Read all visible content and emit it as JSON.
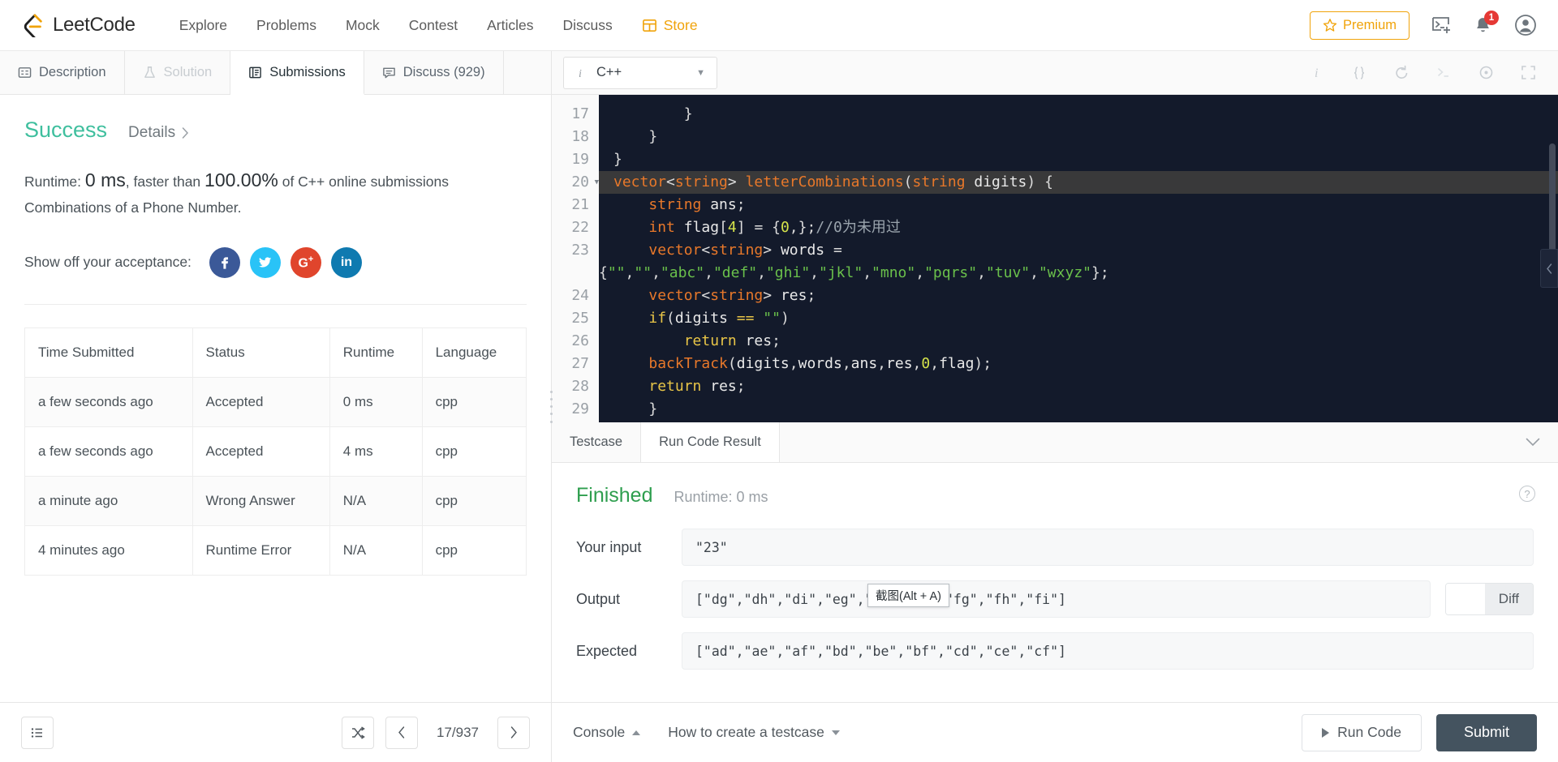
{
  "navbar": {
    "brand": "LeetCode",
    "links": [
      "Explore",
      "Problems",
      "Mock",
      "Contest",
      "Articles",
      "Discuss"
    ],
    "store_label": "Store",
    "premium_label": "Premium",
    "notification_count": "1"
  },
  "left": {
    "tabs": [
      {
        "label": "Description",
        "icon": "description-icon",
        "state": "normal"
      },
      {
        "label": "Solution",
        "icon": "solution-flask-icon",
        "state": "disabled"
      },
      {
        "label": "Submissions",
        "icon": "submissions-icon",
        "state": "active"
      },
      {
        "label": "Discuss (929)",
        "icon": "discuss-icon",
        "state": "normal"
      }
    ],
    "result": {
      "status": "Success",
      "details_label": "Details",
      "runtime_prefix": "Runtime:",
      "runtime_value": "0 ms",
      "faster_text": ", faster than ",
      "percentile": "100.00%",
      "tail_text": " of C++ online submissions Combinations of a Phone Number."
    },
    "share": {
      "label": "Show off your acceptance:",
      "networks": [
        "facebook",
        "twitter",
        "google-plus",
        "linkedin"
      ]
    },
    "table": {
      "headers": [
        "Time Submitted",
        "Status",
        "Runtime",
        "Language"
      ],
      "rows": [
        {
          "time": "a few seconds ago",
          "status": "Accepted",
          "status_kind": "accepted",
          "runtime": "0 ms",
          "language": "cpp"
        },
        {
          "time": "a few seconds ago",
          "status": "Accepted",
          "status_kind": "accepted",
          "runtime": "4 ms",
          "language": "cpp"
        },
        {
          "time": "a minute ago",
          "status": "Wrong Answer",
          "status_kind": "wrong",
          "runtime": "N/A",
          "language": "cpp"
        },
        {
          "time": "4 minutes ago",
          "status": "Runtime Error",
          "status_kind": "error",
          "runtime": "N/A",
          "language": "cpp"
        }
      ]
    },
    "footer": {
      "list_icon": "problem-list-icon",
      "shuffle_icon": "shuffle-icon",
      "prev_icon": "chevron-left-icon",
      "page_indicator": "17/937",
      "next_icon": "chevron-right-icon"
    }
  },
  "editor": {
    "language": "C++",
    "lang_info_icon": "info-icon",
    "tools": [
      "info-icon",
      "format-braces-icon",
      "reset-icon",
      "console-icon",
      "settings-gear-icon",
      "fullscreen-icon"
    ],
    "lines": [
      {
        "num": "17",
        "fold": false,
        "highlight": false,
        "tokens": [
          {
            "t": "        }",
            "c": "k-pun"
          }
        ]
      },
      {
        "num": "18",
        "fold": false,
        "highlight": false,
        "tokens": [
          {
            "t": "    }",
            "c": "k-pun"
          }
        ]
      },
      {
        "num": "19",
        "fold": false,
        "highlight": false,
        "tokens": [
          {
            "t": "}",
            "c": "k-pun"
          }
        ]
      },
      {
        "num": "20",
        "fold": true,
        "highlight": true,
        "tokens": [
          {
            "t": "vector",
            "c": "k-type"
          },
          {
            "t": "<",
            "c": "k-pun"
          },
          {
            "t": "string",
            "c": "k-type"
          },
          {
            "t": "> ",
            "c": "k-pun"
          },
          {
            "t": "letterCombinations",
            "c": "k-fn"
          },
          {
            "t": "(",
            "c": "k-pun"
          },
          {
            "t": "string ",
            "c": "k-type"
          },
          {
            "t": "digits",
            "c": "k-var"
          },
          {
            "t": ") {",
            "c": "k-pun"
          }
        ]
      },
      {
        "num": "21",
        "fold": false,
        "highlight": false,
        "tokens": [
          {
            "t": "    ",
            "c": "k-pun"
          },
          {
            "t": "string ",
            "c": "k-type"
          },
          {
            "t": "ans",
            "c": "k-var"
          },
          {
            "t": ";",
            "c": "k-pun"
          }
        ]
      },
      {
        "num": "22",
        "fold": false,
        "highlight": false,
        "tokens": [
          {
            "t": "    ",
            "c": "k-pun"
          },
          {
            "t": "int ",
            "c": "k-type"
          },
          {
            "t": "flag",
            "c": "k-var"
          },
          {
            "t": "[",
            "c": "k-pun"
          },
          {
            "t": "4",
            "c": "k-num"
          },
          {
            "t": "] = {",
            "c": "k-pun"
          },
          {
            "t": "0",
            "c": "k-num"
          },
          {
            "t": ",};",
            "c": "k-pun"
          },
          {
            "t": "//0为未用过",
            "c": "k-cmt"
          }
        ]
      },
      {
        "num": "23",
        "fold": false,
        "highlight": false,
        "tokens": [
          {
            "t": "    ",
            "c": "k-pun"
          },
          {
            "t": "vector",
            "c": "k-type"
          },
          {
            "t": "<",
            "c": "k-pun"
          },
          {
            "t": "string",
            "c": "k-type"
          },
          {
            "t": "> ",
            "c": "k-pun"
          },
          {
            "t": "words",
            "c": "k-var"
          },
          {
            "t": " =",
            "c": "k-pun"
          }
        ]
      },
      {
        "num": "",
        "fold": false,
        "highlight": false,
        "wrap": true,
        "tokens": [
          {
            "t": "{",
            "c": "k-pun"
          },
          {
            "t": "\"\"",
            "c": "k-str"
          },
          {
            "t": ",",
            "c": "k-pun"
          },
          {
            "t": "\"\"",
            "c": "k-str"
          },
          {
            "t": ",",
            "c": "k-pun"
          },
          {
            "t": "\"abc\"",
            "c": "k-str"
          },
          {
            "t": ",",
            "c": "k-pun"
          },
          {
            "t": "\"def\"",
            "c": "k-str"
          },
          {
            "t": ",",
            "c": "k-pun"
          },
          {
            "t": "\"ghi\"",
            "c": "k-str"
          },
          {
            "t": ",",
            "c": "k-pun"
          },
          {
            "t": "\"jkl\"",
            "c": "k-str"
          },
          {
            "t": ",",
            "c": "k-pun"
          },
          {
            "t": "\"mno\"",
            "c": "k-str"
          },
          {
            "t": ",",
            "c": "k-pun"
          },
          {
            "t": "\"pqrs\"",
            "c": "k-str"
          },
          {
            "t": ",",
            "c": "k-pun"
          },
          {
            "t": "\"tuv\"",
            "c": "k-str"
          },
          {
            "t": ",",
            "c": "k-pun"
          },
          {
            "t": "\"wxyz\"",
            "c": "k-str"
          },
          {
            "t": "};",
            "c": "k-pun"
          }
        ]
      },
      {
        "num": "24",
        "fold": false,
        "highlight": false,
        "tokens": [
          {
            "t": "    ",
            "c": "k-pun"
          },
          {
            "t": "vector",
            "c": "k-type"
          },
          {
            "t": "<",
            "c": "k-pun"
          },
          {
            "t": "string",
            "c": "k-type"
          },
          {
            "t": "> ",
            "c": "k-pun"
          },
          {
            "t": "res",
            "c": "k-var"
          },
          {
            "t": ";",
            "c": "k-pun"
          }
        ]
      },
      {
        "num": "25",
        "fold": false,
        "highlight": false,
        "tokens": [
          {
            "t": "    ",
            "c": "k-pun"
          },
          {
            "t": "if",
            "c": "k-kw"
          },
          {
            "t": "(",
            "c": "k-pun"
          },
          {
            "t": "digits",
            "c": "k-var"
          },
          {
            "t": " ",
            "c": "k-pun"
          },
          {
            "t": "==",
            "c": "k-kw"
          },
          {
            "t": " ",
            "c": "k-pun"
          },
          {
            "t": "\"\"",
            "c": "k-str"
          },
          {
            "t": ")",
            "c": "k-pun"
          }
        ]
      },
      {
        "num": "26",
        "fold": false,
        "highlight": false,
        "tokens": [
          {
            "t": "        ",
            "c": "k-pun"
          },
          {
            "t": "return",
            "c": "k-kw"
          },
          {
            "t": " ",
            "c": "k-pun"
          },
          {
            "t": "res",
            "c": "k-var"
          },
          {
            "t": ";",
            "c": "k-pun"
          }
        ]
      },
      {
        "num": "27",
        "fold": false,
        "highlight": false,
        "tokens": [
          {
            "t": "    ",
            "c": "k-pun"
          },
          {
            "t": "backTrack",
            "c": "k-fn"
          },
          {
            "t": "(",
            "c": "k-pun"
          },
          {
            "t": "digits",
            "c": "k-var"
          },
          {
            "t": ",",
            "c": "k-pun"
          },
          {
            "t": "words",
            "c": "k-var"
          },
          {
            "t": ",",
            "c": "k-pun"
          },
          {
            "t": "ans",
            "c": "k-var"
          },
          {
            "t": ",",
            "c": "k-pun"
          },
          {
            "t": "res",
            "c": "k-var"
          },
          {
            "t": ",",
            "c": "k-pun"
          },
          {
            "t": "0",
            "c": "k-num"
          },
          {
            "t": ",",
            "c": "k-pun"
          },
          {
            "t": "flag",
            "c": "k-var"
          },
          {
            "t": ");",
            "c": "k-pun"
          }
        ]
      },
      {
        "num": "28",
        "fold": false,
        "highlight": false,
        "tokens": [
          {
            "t": "    ",
            "c": "k-pun"
          },
          {
            "t": "return",
            "c": "k-kw"
          },
          {
            "t": " ",
            "c": "k-pun"
          },
          {
            "t": "res",
            "c": "k-var"
          },
          {
            "t": ";",
            "c": "k-pun"
          }
        ]
      },
      {
        "num": "29",
        "fold": false,
        "highlight": false,
        "tokens": [
          {
            "t": "    }",
            "c": "k-pun"
          }
        ]
      }
    ]
  },
  "results": {
    "tabs": [
      {
        "label": "Testcase",
        "active": false
      },
      {
        "label": "Run Code Result",
        "active": true
      }
    ],
    "finished_label": "Finished",
    "runtime_label": "Runtime: 0 ms",
    "help_icon": "help-circle-icon",
    "fields": [
      {
        "label": "Your input",
        "value": "\"23\"",
        "has_diff": false
      },
      {
        "label": "Output",
        "value": "[\"dg\",\"dh\",\"di\",\"eg\",\"eh\",\"ei\",\"fg\",\"fh\",\"fi\"]",
        "has_diff": true
      },
      {
        "label": "Expected",
        "value": "[\"ad\",\"ae\",\"af\",\"bd\",\"be\",\"bf\",\"cd\",\"ce\",\"cf\"]",
        "has_diff": false
      }
    ],
    "diff_label": "Diff",
    "tooltip": "截图(Alt + A)"
  },
  "bottom": {
    "console_label": "Console",
    "testcase_help_label": "How to create a testcase",
    "run_label": "Run Code",
    "submit_label": "Submit"
  },
  "colors": {
    "brand_orange": "#f0a30a",
    "success_teal": "#3fbf9e",
    "finished_green": "#2e9e4e",
    "error_red": "#e53935",
    "submit_dark": "#44535f"
  }
}
